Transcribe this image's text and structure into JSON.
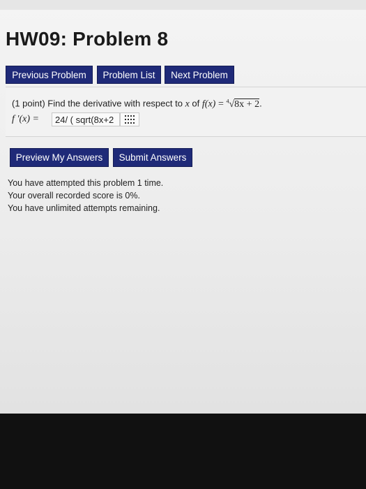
{
  "page": {
    "title": "HW09: Problem 8"
  },
  "nav": {
    "previous_label": "Previous Problem",
    "list_label": "Problem List",
    "next_label": "Next Problem"
  },
  "problem": {
    "prefix": "(1 point) Find the derivative with respect to",
    "variable": "x",
    "of_text": "of",
    "function_lhs": "f(x)",
    "equals": "=",
    "radical_index": "4",
    "radicand": "8x + 2",
    "period": ".",
    "answer_label": "f ′(x) =",
    "answer_value": "24/ ( sqrt(8x+2"
  },
  "actions": {
    "preview_label": "Preview My Answers",
    "submit_label": "Submit Answers"
  },
  "status": {
    "line1": "You have attempted this problem 1 time.",
    "line2": "Your overall recorded score is 0%.",
    "line3": "You have unlimited attempts remaining."
  },
  "icons": {
    "equation_editor": "grid-icon"
  },
  "colors": {
    "button_bg": "#1f2a78",
    "button_text": "#ffffff"
  }
}
